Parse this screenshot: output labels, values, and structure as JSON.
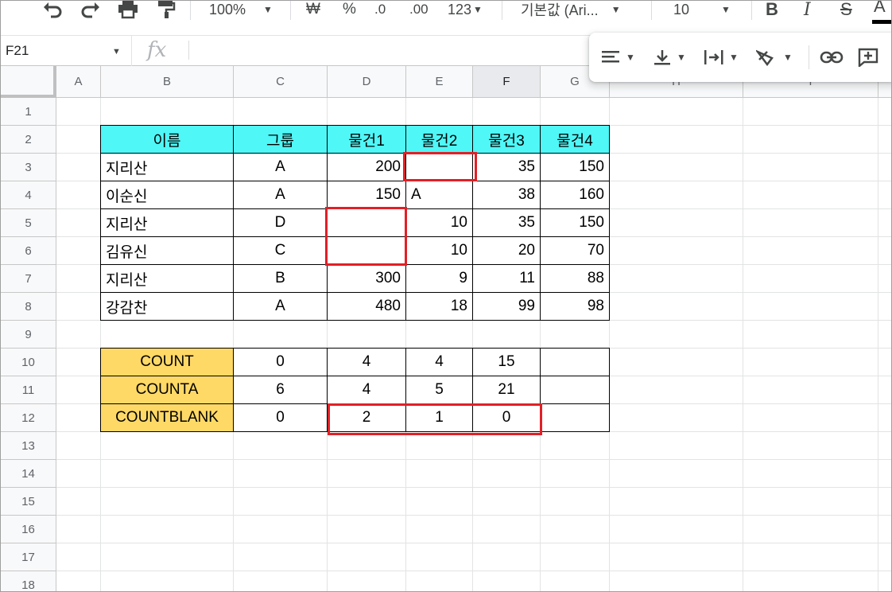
{
  "toolbar": {
    "zoom": "100%",
    "currency": "₩",
    "percent": "%",
    "decimal_decrease": ".0",
    "decimal_increase": ".00",
    "more_formats": "123",
    "font": "기본값 (Ari...",
    "font_size": "10",
    "bold": "B",
    "italic": "I",
    "strike": "S",
    "text_color": "A"
  },
  "formula_bar": {
    "cell_ref": "F21",
    "fx": "fx",
    "value": ""
  },
  "columns": [
    "A",
    "B",
    "C",
    "D",
    "E",
    "F",
    "G",
    "H",
    "I"
  ],
  "selected_column": "F",
  "rows": [
    "1",
    "2",
    "3",
    "4",
    "5",
    "6",
    "7",
    "8",
    "9",
    "10",
    "11",
    "12",
    "13",
    "14",
    "15",
    "16",
    "17",
    "18"
  ],
  "table": {
    "headers": [
      "이름",
      "그룹",
      "물건1",
      "물건2",
      "물건3",
      "물건4"
    ],
    "rows": [
      [
        "지리산",
        "A",
        "200",
        "",
        "35",
        "150"
      ],
      [
        "이순신",
        "A",
        "150",
        "A",
        "38",
        "160"
      ],
      [
        "지리산",
        "D",
        "",
        "10",
        "35",
        "150"
      ],
      [
        "김유신",
        "C",
        "",
        "10",
        "20",
        "70"
      ],
      [
        "지리산",
        "B",
        "300",
        "9",
        "11",
        "88"
      ],
      [
        "강감찬",
        "A",
        "480",
        "18",
        "99",
        "98"
      ]
    ]
  },
  "summary": {
    "rows": [
      [
        "COUNT",
        "0",
        "4",
        "4",
        "15",
        ""
      ],
      [
        "COUNTA",
        "6",
        "4",
        "5",
        "21",
        ""
      ],
      [
        "COUNTBLANK",
        "0",
        "2",
        "1",
        "0",
        ""
      ]
    ]
  },
  "colors": {
    "header_fill": "#4ff7f7",
    "summary_fill": "#ffd966",
    "highlight": "#e21f26",
    "selected_header": "#e8eaed"
  }
}
